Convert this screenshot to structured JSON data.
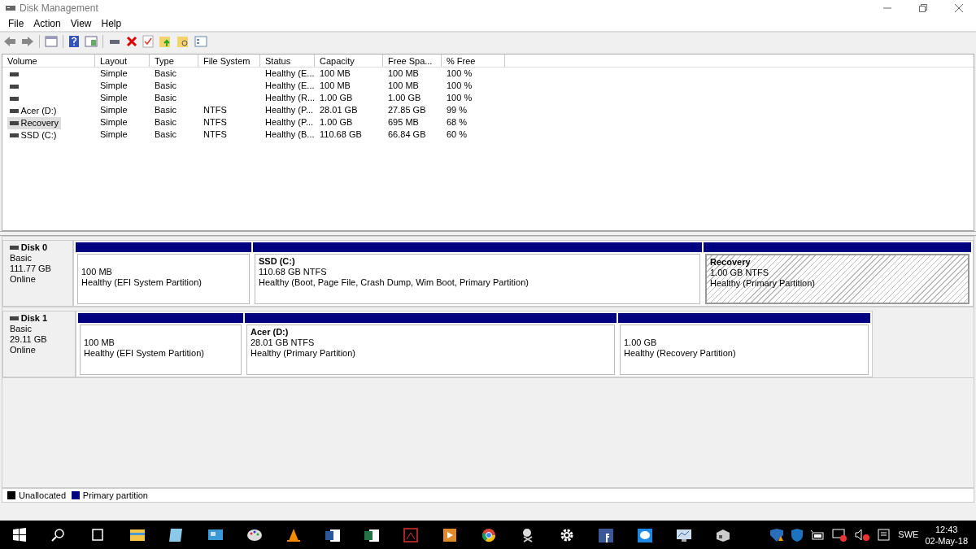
{
  "window": {
    "title": "Disk Management"
  },
  "menu": [
    "File",
    "Action",
    "View",
    "Help"
  ],
  "table": {
    "columns": [
      "Volume",
      "Layout",
      "Type",
      "File System",
      "Status",
      "Capacity",
      "Free Spa...",
      "% Free"
    ],
    "rows": [
      {
        "selected": false,
        "cells": [
          "",
          "Simple",
          "Basic",
          "",
          "Healthy (E...",
          "100 MB",
          "100 MB",
          "100 %"
        ]
      },
      {
        "selected": false,
        "cells": [
          "",
          "Simple",
          "Basic",
          "",
          "Healthy (E...",
          "100 MB",
          "100 MB",
          "100 %"
        ]
      },
      {
        "selected": false,
        "cells": [
          "",
          "Simple",
          "Basic",
          "",
          "Healthy (R...",
          "1.00 GB",
          "1.00 GB",
          "100 %"
        ]
      },
      {
        "selected": false,
        "cells": [
          "Acer (D:)",
          "Simple",
          "Basic",
          "NTFS",
          "Healthy (P...",
          "28.01 GB",
          "27.85 GB",
          "99 %"
        ]
      },
      {
        "selected": true,
        "cells": [
          "Recovery",
          "Simple",
          "Basic",
          "NTFS",
          "Healthy (P...",
          "1.00 GB",
          "695 MB",
          "68 %"
        ]
      },
      {
        "selected": false,
        "cells": [
          "SSD (C:)",
          "Simple",
          "Basic",
          "NTFS",
          "Healthy (B...",
          "110.68 GB",
          "66.84 GB",
          "60 %"
        ]
      }
    ]
  },
  "disks": [
    {
      "name": "Disk 0",
      "type": "Basic",
      "size": "111.77 GB",
      "state": "Online",
      "partitions": [
        {
          "size": "100 MB",
          "status": "Healthy (EFI System Partition)",
          "selected": false
        },
        {
          "name": "SSD  (C:)",
          "size": "110.68 GB NTFS",
          "status": "Healthy (Boot, Page File, Crash Dump, Wim Boot, Primary Partition)",
          "selected": false
        },
        {
          "name": "Recovery",
          "size": "1.00 GB NTFS",
          "status": "Healthy (Primary Partition)",
          "selected": true
        }
      ]
    },
    {
      "name": "Disk 1",
      "type": "Basic",
      "size": "29.11 GB",
      "state": "Online",
      "partitions": [
        {
          "size": "100 MB",
          "status": "Healthy (EFI System Partition)",
          "selected": false
        },
        {
          "name": "Acer  (D:)",
          "size": "28.01 GB NTFS",
          "status": "Healthy (Primary Partition)",
          "selected": false
        },
        {
          "size": "1.00 GB",
          "status": "Healthy (Recovery Partition)",
          "selected": false
        }
      ]
    }
  ],
  "legend": [
    {
      "label": "Unallocated",
      "color": "#000000"
    },
    {
      "label": "Primary partition",
      "color": "#000080"
    }
  ],
  "taskbar": {
    "language": "SWE",
    "time": "12:43",
    "date": "02-May-18"
  }
}
